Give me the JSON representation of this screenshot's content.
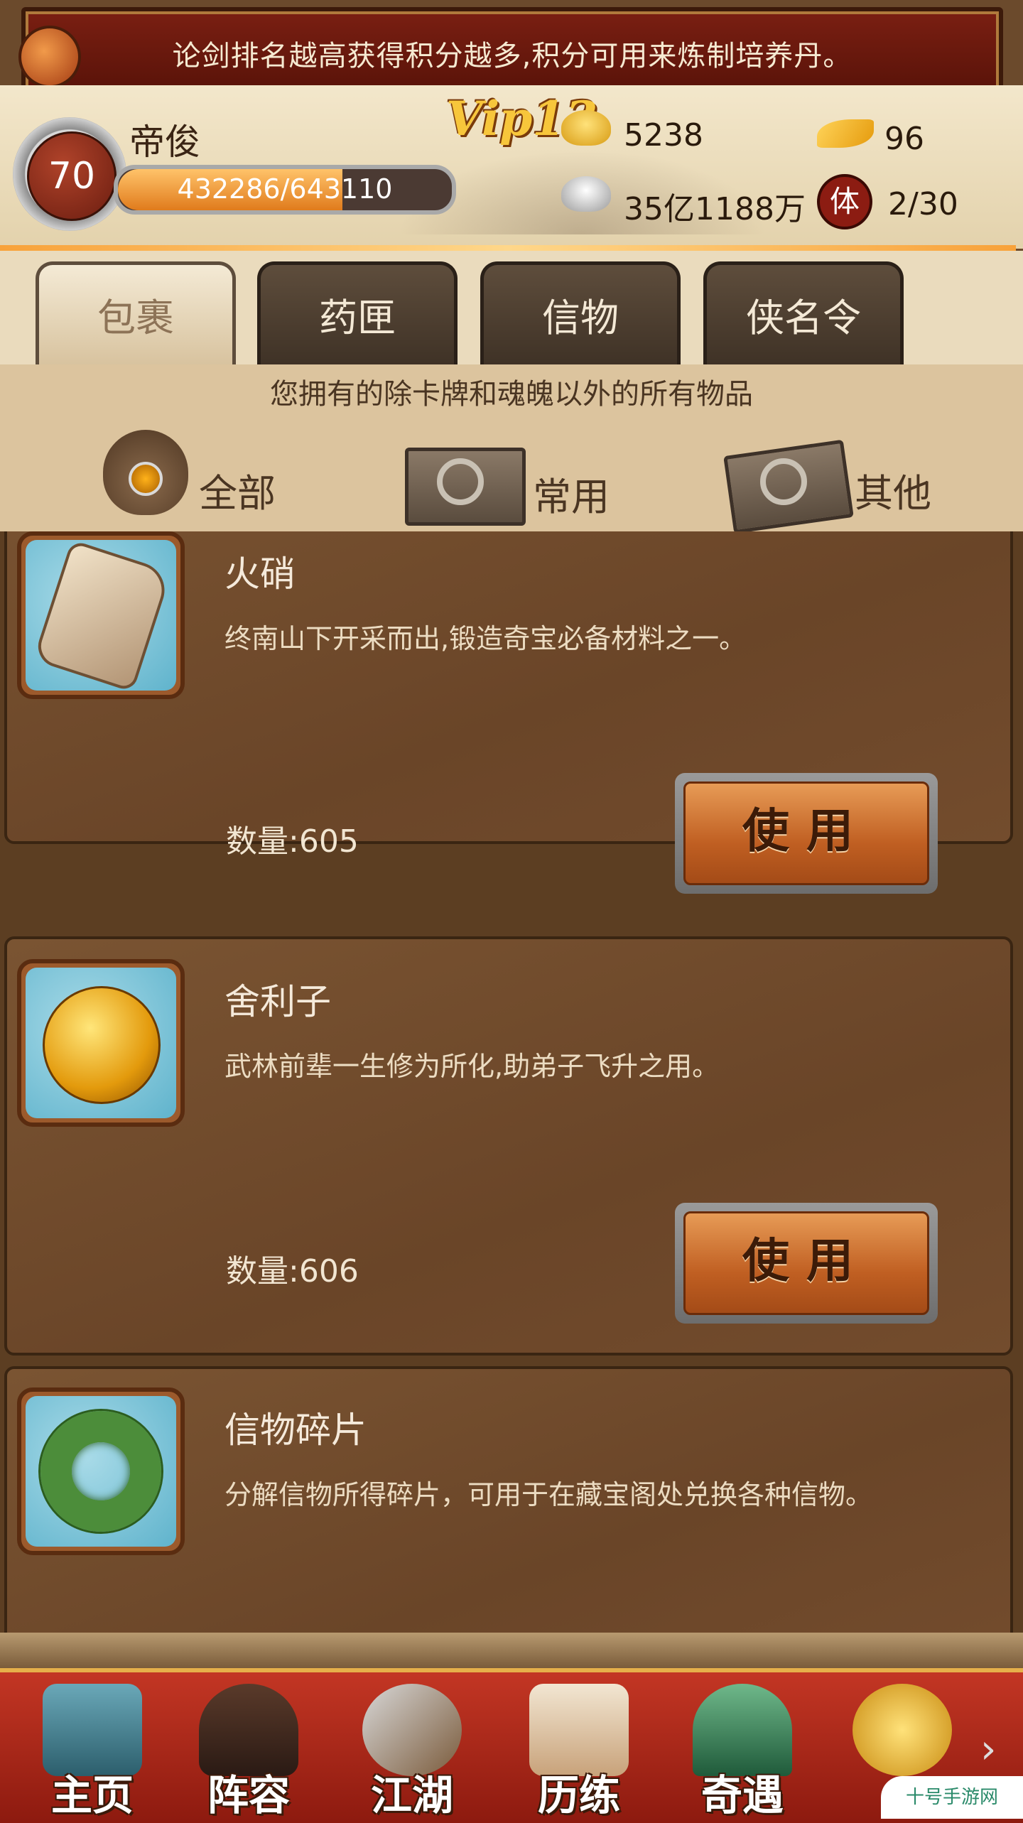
{
  "ticker": {
    "text": "论剑排名越高获得积分越多,积分可用来炼制培养丹。"
  },
  "player": {
    "level": "70",
    "name": "帝俊",
    "xp": "432286/643110",
    "xp_fraction": 0.672,
    "vip": "Vip13"
  },
  "currency": {
    "gold": "5238",
    "feather": "96",
    "silver": "35亿1188万",
    "stamina_icon_char": "体",
    "stamina": "2/30"
  },
  "tabs": [
    {
      "label": "包裹",
      "active": true
    },
    {
      "label": "药匣",
      "active": false
    },
    {
      "label": "信物",
      "active": false
    },
    {
      "label": "侠名令",
      "active": false
    }
  ],
  "category": {
    "description": "您拥有的除卡牌和魂魄以外的所有物品",
    "items": [
      {
        "label": "全部",
        "icon": "bag-icon"
      },
      {
        "label": "常用",
        "icon": "box-icon"
      },
      {
        "label": "其他",
        "icon": "open-box-icon"
      }
    ]
  },
  "items": [
    {
      "name": "火硝",
      "desc": "终南山下开采而出,锻造奇宝必备材料之一。",
      "qty_label": "数量:",
      "qty": "605",
      "button": "使用",
      "icon": "saltpeter-icon"
    },
    {
      "name": "舍利子",
      "desc": "武林前辈一生修为所化,助弟子飞升之用。",
      "qty_label": "数量:",
      "qty": "606",
      "button": "使用",
      "icon": "sarira-icon"
    },
    {
      "name": "信物碎片",
      "desc": "分解信物所得碎片，可用于在藏宝阁处兑换各种信物。",
      "qty_label": "",
      "qty": "",
      "button": "",
      "icon": "jade-ring-icon"
    }
  ],
  "nav": [
    {
      "label": "主页",
      "icon": "palace-icon"
    },
    {
      "label": "阵容",
      "icon": "hero-icon"
    },
    {
      "label": "江湖",
      "icon": "sword-icon"
    },
    {
      "label": "历练",
      "icon": "scroll-icon"
    },
    {
      "label": "奇遇",
      "icon": "mountain-icon"
    },
    {
      "label": "",
      "icon": "treasure-icon"
    }
  ],
  "watermark": "十号手游网",
  "colors": {
    "accent": "#f8a23a",
    "nav": "#c33624",
    "panel": "#6a4528"
  }
}
